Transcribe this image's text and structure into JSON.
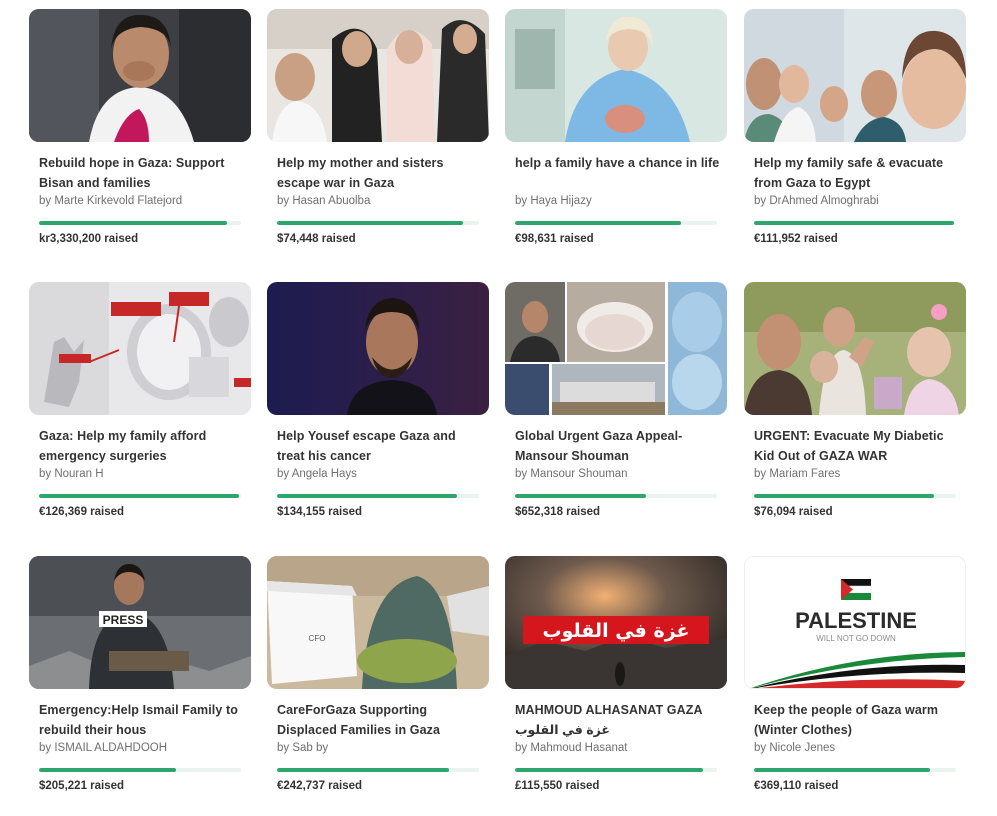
{
  "brand_color": "#2ea66b",
  "raised_suffix": "raised",
  "cards": [
    {
      "title": "Rebuild hope in Gaza: Support Bisan and families",
      "author": "by Marte Kirkevold Flatejord",
      "amount": "kr3,330,200",
      "progress": 0.93
    },
    {
      "title": "Help my mother and sisters escape war in Gaza",
      "author": "by Hasan Abuolba",
      "amount": "$74,448",
      "progress": 0.92
    },
    {
      "title": "help a family have a chance in life",
      "author": "by Haya Hijazy",
      "amount": "€98,631",
      "progress": 0.82
    },
    {
      "title": "Help my family safe & evacuate from Gaza to Egypt",
      "author": "by DrAhmed Almoghrabi",
      "amount": "€111,952",
      "progress": 0.99
    },
    {
      "title": "Gaza: Help my family afford emergency surgeries",
      "author": "by Nouran H",
      "amount": "€126,369",
      "progress": 0.99
    },
    {
      "title": "Help Yousef escape Gaza and treat his cancer",
      "author": "by Angela Hays",
      "amount": "$134,155",
      "progress": 0.89
    },
    {
      "title": "Global Urgent Gaza Appeal- Mansour Shouman",
      "author": "by Mansour Shouman",
      "amount": "$652,318",
      "progress": 0.65
    },
    {
      "title": "URGENT: Evacuate My Diabetic Kid Out of GAZA WAR",
      "author": "by Mariam Fares",
      "amount": "$76,094",
      "progress": 0.89
    },
    {
      "title": "Emergency:Help Ismail Family to rebuild their hous",
      "author": "by ISMAIL ALDAHDOOH",
      "amount": "$205,221",
      "progress": 0.68
    },
    {
      "title": "CareForGaza Supporting Displaced Families in Gaza",
      "author": "by Sab by",
      "amount": "€242,737",
      "progress": 0.85
    },
    {
      "title": "MAHMOUD ALHASANAT GAZA غزة في القلوب",
      "author": "by Mahmoud Hasanat",
      "amount": "£115,550",
      "progress": 0.93
    },
    {
      "title": "Keep the people of Gaza warm (Winter Clothes)",
      "author": "by Nicole Jenes",
      "amount": "€369,110",
      "progress": 0.87
    }
  ],
  "image_text": {
    "press": "PRESS",
    "palestine": "PALESTINE",
    "will_not": "WILL NOT GO DOWN",
    "arabic_banner": "غزة في القلوب",
    "box_label": "CFO"
  }
}
